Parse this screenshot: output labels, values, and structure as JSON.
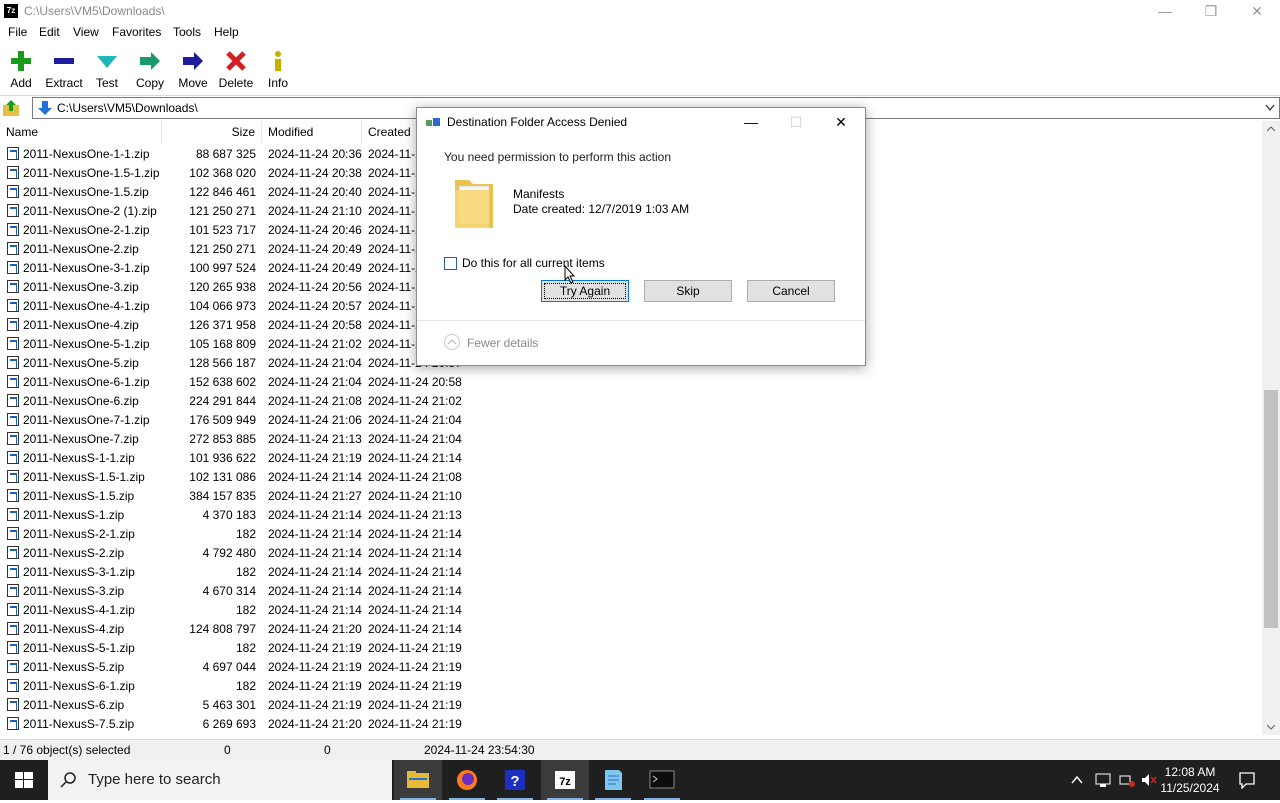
{
  "window": {
    "app_icon": "7z",
    "title": "C:\\Users\\VM5\\Downloads\\",
    "minimize": "—",
    "restore": "❐",
    "close": "✕"
  },
  "menu": [
    "File",
    "Edit",
    "View",
    "Favorites",
    "Tools",
    "Help"
  ],
  "toolbar": [
    {
      "label": "Add",
      "icon": "plus-icon",
      "color": "#1a9a1a"
    },
    {
      "label": "Extract",
      "icon": "minus-icon",
      "color": "#1c1c9c"
    },
    {
      "label": "Test",
      "icon": "check-icon",
      "color": "#20b8b8"
    },
    {
      "label": "Copy",
      "icon": "double-arrow-icon",
      "color": "#1a9a6a"
    },
    {
      "label": "Move",
      "icon": "arrow-right-icon",
      "color": "#1c1c9c"
    },
    {
      "label": "Delete",
      "icon": "x-icon",
      "color": "#d42020"
    },
    {
      "label": "Info",
      "icon": "info-icon",
      "color": "#c8b000"
    }
  ],
  "address": {
    "path": "C:\\Users\\VM5\\Downloads\\"
  },
  "columns": {
    "name": "Name",
    "size": "Size",
    "modified": "Modified",
    "created": "Created"
  },
  "files": [
    {
      "name": "2011-NexusOne-1-1.zip",
      "size": "88 687 325",
      "modified": "2024-11-24 20:36",
      "created": "2024-11-24 20:32"
    },
    {
      "name": "2011-NexusOne-1.5-1.zip",
      "size": "102 368 020",
      "modified": "2024-11-24 20:38",
      "created": "2024-11-24 20:34"
    },
    {
      "name": "2011-NexusOne-1.5.zip",
      "size": "122 846 461",
      "modified": "2024-11-24 20:40",
      "created": "2024-11-24 20:36"
    },
    {
      "name": "2011-NexusOne-2 (1).zip",
      "size": "121 250 271",
      "modified": "2024-11-24 21:10",
      "created": "2024-11-24 21:06"
    },
    {
      "name": "2011-NexusOne-2-1.zip",
      "size": "101 523 717",
      "modified": "2024-11-24 20:46",
      "created": "2024-11-24 20:42"
    },
    {
      "name": "2011-NexusOne-2.zip",
      "size": "121 250 271",
      "modified": "2024-11-24 20:49",
      "created": "2024-11-24 20:45"
    },
    {
      "name": "2011-NexusOne-3-1.zip",
      "size": "100 997 524",
      "modified": "2024-11-24 20:49",
      "created": "2024-11-24 20:45"
    },
    {
      "name": "2011-NexusOne-3.zip",
      "size": "120 265 938",
      "modified": "2024-11-24 20:56",
      "created": "2024-11-24 20:52"
    },
    {
      "name": "2011-NexusOne-4-1.zip",
      "size": "104 066 973",
      "modified": "2024-11-24 20:57",
      "created": "2024-11-24 20:53"
    },
    {
      "name": "2011-NexusOne-4.zip",
      "size": "126 371 958",
      "modified": "2024-11-24 20:58",
      "created": "2024-11-24 20:54"
    },
    {
      "name": "2011-NexusOne-5-1.zip",
      "size": "105 168 809",
      "modified": "2024-11-24 21:02",
      "created": "2024-11-24 20:58"
    },
    {
      "name": "2011-NexusOne-5.zip",
      "size": "128 566 187",
      "modified": "2024-11-24 21:04",
      "created": "2024-11-24 20:57"
    },
    {
      "name": "2011-NexusOne-6-1.zip",
      "size": "152 638 602",
      "modified": "2024-11-24 21:04",
      "created": "2024-11-24 20:58"
    },
    {
      "name": "2011-NexusOne-6.zip",
      "size": "224 291 844",
      "modified": "2024-11-24 21:08",
      "created": "2024-11-24 21:02"
    },
    {
      "name": "2011-NexusOne-7-1.zip",
      "size": "176 509 949",
      "modified": "2024-11-24 21:06",
      "created": "2024-11-24 21:04"
    },
    {
      "name": "2011-NexusOne-7.zip",
      "size": "272 853 885",
      "modified": "2024-11-24 21:13",
      "created": "2024-11-24 21:04"
    },
    {
      "name": "2011-NexusS-1-1.zip",
      "size": "101 936 622",
      "modified": "2024-11-24 21:19",
      "created": "2024-11-24 21:14"
    },
    {
      "name": "2011-NexusS-1.5-1.zip",
      "size": "102 131 086",
      "modified": "2024-11-24 21:14",
      "created": "2024-11-24 21:08"
    },
    {
      "name": "2011-NexusS-1.5.zip",
      "size": "384 157 835",
      "modified": "2024-11-24 21:27",
      "created": "2024-11-24 21:10"
    },
    {
      "name": "2011-NexusS-1.zip",
      "size": "4 370 183",
      "modified": "2024-11-24 21:14",
      "created": "2024-11-24 21:13"
    },
    {
      "name": "2011-NexusS-2-1.zip",
      "size": "182",
      "modified": "2024-11-24 21:14",
      "created": "2024-11-24 21:14"
    },
    {
      "name": "2011-NexusS-2.zip",
      "size": "4 792 480",
      "modified": "2024-11-24 21:14",
      "created": "2024-11-24 21:14"
    },
    {
      "name": "2011-NexusS-3-1.zip",
      "size": "182",
      "modified": "2024-11-24 21:14",
      "created": "2024-11-24 21:14"
    },
    {
      "name": "2011-NexusS-3.zip",
      "size": "4 670 314",
      "modified": "2024-11-24 21:14",
      "created": "2024-11-24 21:14"
    },
    {
      "name": "2011-NexusS-4-1.zip",
      "size": "182",
      "modified": "2024-11-24 21:14",
      "created": "2024-11-24 21:14"
    },
    {
      "name": "2011-NexusS-4.zip",
      "size": "124 808 797",
      "modified": "2024-11-24 21:20",
      "created": "2024-11-24 21:14"
    },
    {
      "name": "2011-NexusS-5-1.zip",
      "size": "182",
      "modified": "2024-11-24 21:19",
      "created": "2024-11-24 21:19"
    },
    {
      "name": "2011-NexusS-5.zip",
      "size": "4 697 044",
      "modified": "2024-11-24 21:19",
      "created": "2024-11-24 21:19"
    },
    {
      "name": "2011-NexusS-6-1.zip",
      "size": "182",
      "modified": "2024-11-24 21:19",
      "created": "2024-11-24 21:19"
    },
    {
      "name": "2011-NexusS-6.zip",
      "size": "5 463 301",
      "modified": "2024-11-24 21:19",
      "created": "2024-11-24 21:19"
    },
    {
      "name": "2011-NexusS-7.5.zip",
      "size": "6 269 693",
      "modified": "2024-11-24 21:20",
      "created": "2024-11-24 21:19"
    }
  ],
  "status": {
    "selected": "1 / 76 object(s) selected",
    "size1": "0",
    "size2": "0",
    "date": "2024-11-24 23:54:30"
  },
  "dialog": {
    "title": "Destination Folder Access Denied",
    "message": "You need permission to perform this action",
    "item_name": "Manifests",
    "item_date": "Date created: 12/7/2019 1:03 AM",
    "checkbox_label": "Do this for all current items",
    "checkbox_checked": false,
    "buttons": {
      "try_again": "Try Again",
      "skip": "Skip",
      "cancel": "Cancel"
    },
    "fewer_details": "Fewer details"
  },
  "taskbar": {
    "search_placeholder": "Type here to search",
    "time": "12:08 AM",
    "date": "11/25/2024"
  }
}
